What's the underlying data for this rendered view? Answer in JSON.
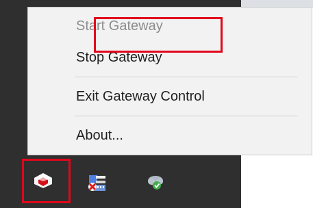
{
  "context_menu": {
    "items": [
      {
        "label": "Start Gateway",
        "enabled": false,
        "highlighted": true
      },
      {
        "label": "Stop Gateway",
        "enabled": true
      },
      {
        "label": "Exit Gateway Control",
        "enabled": true
      },
      {
        "label": "About...",
        "enabled": true
      }
    ]
  },
  "tray": {
    "icons": [
      {
        "name": "gateway-control-icon",
        "highlighted": true
      },
      {
        "name": "network-error-icon"
      },
      {
        "name": "cloud-sync-check-icon"
      }
    ]
  },
  "colors": {
    "taskbar_background": "#2f2f2f",
    "menu_background": "#f2f2f2",
    "highlight_border": "#e2061b",
    "disabled_text": "#8c8c8c",
    "enabled_text": "#1f1f1f"
  }
}
